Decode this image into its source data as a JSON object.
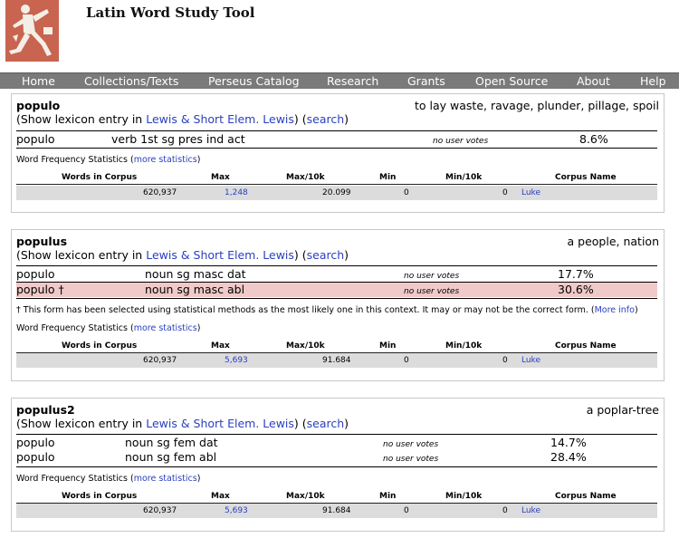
{
  "site": {
    "title": "Latin Word Study Tool"
  },
  "nav": [
    "Home",
    "Collections/Texts",
    "Perseus Catalog",
    "Research",
    "Grants",
    "Open Source",
    "About",
    "Help"
  ],
  "lexicon": {
    "prefix": "(Show lexicon entry in ",
    "link1": "Lewis & Short",
    "link2": "Elem. Lewis",
    "search_link": "search",
    "close": ")"
  },
  "freq": {
    "label": "Word Frequency Statistics (",
    "more_link": "more statistics",
    "close": ")",
    "headers": [
      "Words in Corpus",
      "Max",
      "Max/10k",
      "Min",
      "Min/10k",
      "Corpus Name"
    ]
  },
  "entries": [
    {
      "lemma": "populo",
      "definition": "to lay waste, ravage, plunder, pillage, spoil",
      "analyses": [
        {
          "form": "populo",
          "parse": "verb 1st sg pres ind act",
          "votes": "no user votes",
          "pct": "8.6%"
        }
      ],
      "stats": {
        "words": "620,937",
        "max": "1,248",
        "max10k": "20.099",
        "min": "0",
        "min10k": "0",
        "corpus": "Luke"
      }
    },
    {
      "lemma": "populus",
      "definition": "a people, nation",
      "analyses": [
        {
          "form": "populo",
          "parse": "noun sg masc dat",
          "votes": "no user votes",
          "pct": "17.7%"
        },
        {
          "form": "populo †",
          "parse": "noun sg masc abl",
          "votes": "no user votes",
          "pct": "30.6%"
        }
      ],
      "note": {
        "text": "† This form has been selected using statistical methods as the most likely one in this context. It may or may not be the correct form. (",
        "link": "More info",
        "close": ")"
      },
      "stats": {
        "words": "620,937",
        "max": "5,693",
        "max10k": "91.684",
        "min": "0",
        "min10k": "0",
        "corpus": "Luke"
      }
    },
    {
      "lemma": "populus2",
      "definition": "a poplar-tree",
      "analyses": [
        {
          "form": "populo",
          "parse": "noun sg fem dat",
          "votes": "no user votes",
          "pct": "14.7%"
        },
        {
          "form": "populo",
          "parse": "noun sg fem abl",
          "votes": "no user votes",
          "pct": "28.4%"
        }
      ],
      "stats": {
        "words": "620,937",
        "max": "5,693",
        "max10k": "91.684",
        "min": "0",
        "min10k": "0",
        "corpus": "Luke"
      }
    }
  ]
}
